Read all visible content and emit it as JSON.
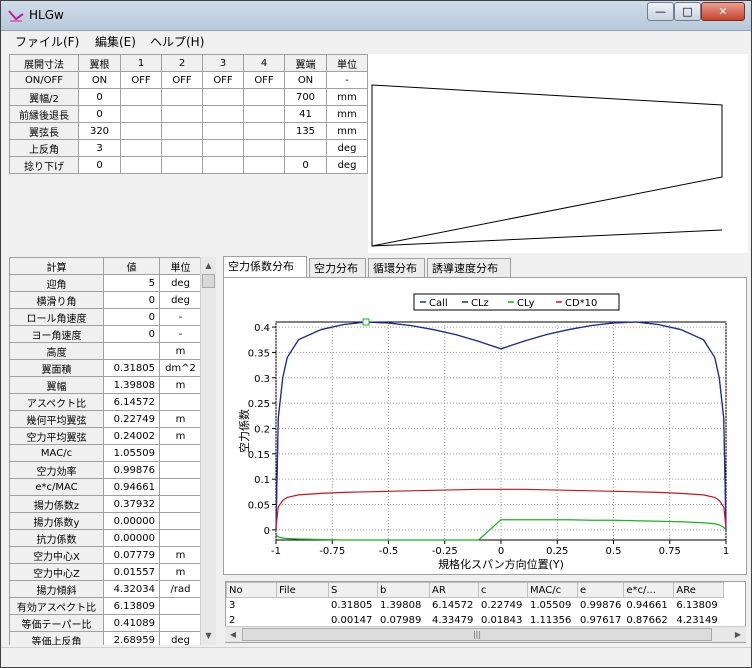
{
  "window": {
    "title": "HLGw"
  },
  "menu": [
    {
      "label": "ファイル(F)"
    },
    {
      "label": "編集(E)"
    },
    {
      "label": "ヘルプ(H)"
    }
  ],
  "wing_table": {
    "header": [
      "展開寸法",
      "翼根",
      "1",
      "2",
      "3",
      "4",
      "翼端",
      "単位"
    ],
    "rows": [
      {
        "label": "ON/OFF",
        "cells": [
          "ON",
          "OFF",
          "OFF",
          "OFF",
          "OFF",
          "ON",
          "-"
        ]
      },
      {
        "label": "翼幅/2",
        "cells": [
          "0",
          "",
          "",
          "",
          "",
          "700",
          "mm"
        ]
      },
      {
        "label": "前縁後退長",
        "cells": [
          "0",
          "",
          "",
          "",
          "",
          "41",
          "mm"
        ]
      },
      {
        "label": "翼弦長",
        "cells": [
          "320",
          "",
          "",
          "",
          "",
          "135",
          "mm"
        ]
      },
      {
        "label": "上反角",
        "cells": [
          "3",
          "",
          "",
          "",
          "",
          "",
          "deg"
        ]
      },
      {
        "label": "捻り下げ",
        "cells": [
          "0",
          "",
          "",
          "",
          "",
          "0",
          "deg"
        ]
      }
    ]
  },
  "calc_table": {
    "header": [
      "計算",
      "値",
      "単位"
    ],
    "rows": [
      {
        "label": "迎角",
        "value": "5",
        "unit": "deg"
      },
      {
        "label": "横滑り角",
        "value": "0",
        "unit": "deg"
      },
      {
        "label": "ロール角速度",
        "value": "0",
        "unit": "-"
      },
      {
        "label": "ヨー角速度",
        "value": "0",
        "unit": "-"
      },
      {
        "label": "高度",
        "value": "",
        "unit": "m"
      },
      {
        "label": "翼面積",
        "value": "0.31805",
        "unit": "dm^2"
      },
      {
        "label": "翼幅",
        "value": "1.39808",
        "unit": "m"
      },
      {
        "label": "アスペクト比",
        "value": "6.14572",
        "unit": ""
      },
      {
        "label": "幾何平均翼弦",
        "value": "0.22749",
        "unit": "m"
      },
      {
        "label": "空力平均翼弦",
        "value": "0.24002",
        "unit": "m"
      },
      {
        "label": "MAC/c",
        "value": "1.05509",
        "unit": ""
      },
      {
        "label": "空力効率",
        "value": "0.99876",
        "unit": ""
      },
      {
        "label": "e*c/MAC",
        "value": "0.94661",
        "unit": ""
      },
      {
        "label": "揚力係数z",
        "value": "0.37932",
        "unit": ""
      },
      {
        "label": "揚力係数y",
        "value": "0.00000",
        "unit": ""
      },
      {
        "label": "抗力係数",
        "value": "0.00000",
        "unit": ""
      },
      {
        "label": "空力中心X",
        "value": "0.07779",
        "unit": "m"
      },
      {
        "label": "空力中心Z",
        "value": "0.01557",
        "unit": "m"
      },
      {
        "label": "揚力傾斜",
        "value": "4.32034",
        "unit": "/rad"
      },
      {
        "label": "有効アスペクト比",
        "value": "6.13809",
        "unit": ""
      },
      {
        "label": "等価テーパー比",
        "value": "0.41089",
        "unit": ""
      },
      {
        "label": "等価上反角",
        "value": "2.68959",
        "unit": "deg"
      }
    ]
  },
  "tabs": [
    {
      "label": "空力係数分布"
    },
    {
      "label": "空力分布"
    },
    {
      "label": "循環分布"
    },
    {
      "label": "誘導速度分布"
    }
  ],
  "chart_data": {
    "type": "line",
    "xlabel": "規格化スパン方向位置(Y)",
    "ylabel": "空力係数",
    "xlim": [
      -1,
      1
    ],
    "ylim": [
      -0.02,
      0.41
    ],
    "x_ticks": [
      "-1",
      "-0.75",
      "-0.5",
      "-0.25",
      "0",
      "0.25",
      "0.5",
      "0.75",
      "1"
    ],
    "y_ticks": [
      "0",
      "0.05",
      "0.1",
      "0.15",
      "0.2",
      "0.25",
      "0.3",
      "0.35",
      "0.4"
    ],
    "grid": true,
    "legend_position": "top",
    "x": [
      -1,
      -0.99,
      -0.97,
      -0.95,
      -0.9,
      -0.8,
      -0.7,
      -0.6,
      -0.5,
      -0.4,
      -0.3,
      -0.2,
      -0.1,
      0,
      0.1,
      0.2,
      0.3,
      0.4,
      0.5,
      0.6,
      0.7,
      0.8,
      0.9,
      0.95,
      0.97,
      0.99,
      1
    ],
    "series": [
      {
        "name": "Call",
        "color": "#1f2e8c",
        "values": [
          0,
          0.22,
          0.3,
          0.34,
          0.375,
          0.395,
          0.405,
          0.41,
          0.408,
          0.403,
          0.395,
          0.385,
          0.372,
          0.357,
          0.372,
          0.385,
          0.395,
          0.403,
          0.408,
          0.41,
          0.405,
          0.395,
          0.375,
          0.34,
          0.3,
          0.22,
          0
        ]
      },
      {
        "name": "CLz",
        "color": "#1f2e8c",
        "values": [
          0,
          0.22,
          0.3,
          0.34,
          0.375,
          0.395,
          0.405,
          0.41,
          0.408,
          0.403,
          0.395,
          0.385,
          0.372,
          0.357,
          0.372,
          0.385,
          0.395,
          0.403,
          0.408,
          0.41,
          0.405,
          0.395,
          0.375,
          0.34,
          0.3,
          0.22,
          0
        ]
      },
      {
        "name": "CLy",
        "color": "#19b21e",
        "values": [
          -0.01,
          -0.014,
          -0.016,
          -0.017,
          -0.018,
          -0.019,
          -0.02,
          -0.02,
          -0.02,
          -0.02,
          -0.02,
          -0.02,
          -0.02,
          0.02,
          0.02,
          0.02,
          0.02,
          0.019,
          0.019,
          0.018,
          0.017,
          0.016,
          0.014,
          0.012,
          0.01,
          0.005,
          0
        ]
      },
      {
        "name": "CD*10",
        "color": "#c8161d",
        "values": [
          0.005,
          0.045,
          0.058,
          0.064,
          0.069,
          0.072,
          0.074,
          0.075,
          0.076,
          0.077,
          0.078,
          0.079,
          0.08,
          0.08,
          0.08,
          0.079,
          0.078,
          0.077,
          0.076,
          0.075,
          0.074,
          0.072,
          0.069,
          0.064,
          0.058,
          0.045,
          0.005
        ]
      }
    ]
  },
  "results_table": {
    "header": [
      "No",
      "File",
      "S",
      "b",
      "AR",
      "c",
      "MAC/c",
      "e",
      "e*c/...",
      "ARe"
    ],
    "rows": [
      [
        "3",
        "",
        "0.31805",
        "1.39808",
        "6.14572",
        "0.22749",
        "1.05509",
        "0.99876",
        "0.94661",
        "6.13809"
      ],
      [
        "2",
        "",
        "0.00147",
        "0.07989",
        "4.33479",
        "0.01843",
        "1.11356",
        "0.97617",
        "0.87662",
        "4.23149"
      ]
    ]
  }
}
